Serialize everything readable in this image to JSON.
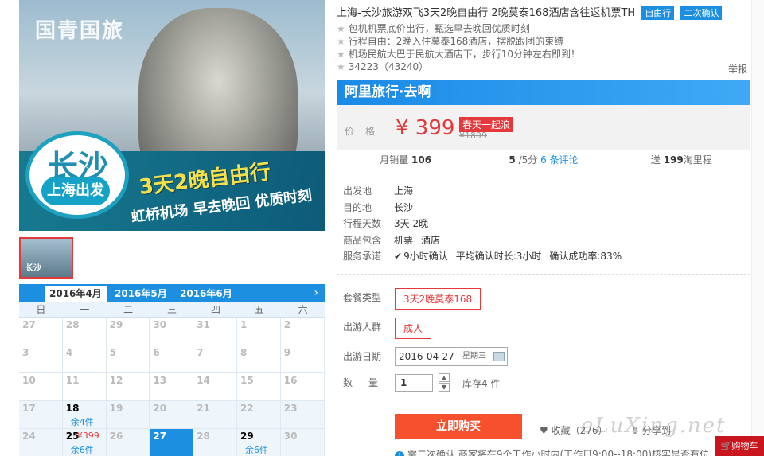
{
  "hero": {
    "brand": "国青国旅",
    "city": "长沙",
    "from": "上海出发",
    "slogan": "3天2晚自由行",
    "tags": "虹桥机场 早去晚回 优质时刻"
  },
  "thumb": {
    "label": "长沙"
  },
  "calendar": {
    "months": [
      "2016年4月",
      "2016年5月",
      "2016年6月"
    ],
    "weekdays": [
      "日",
      "一",
      "二",
      "三",
      "四",
      "五",
      "六"
    ],
    "cells": [
      {
        "d": "27"
      },
      {
        "d": "28"
      },
      {
        "d": "29"
      },
      {
        "d": "30"
      },
      {
        "d": "31"
      },
      {
        "d": "1"
      },
      {
        "d": "2"
      },
      {
        "d": "3"
      },
      {
        "d": "4"
      },
      {
        "d": "5"
      },
      {
        "d": "6"
      },
      {
        "d": "7"
      },
      {
        "d": "8"
      },
      {
        "d": "9"
      },
      {
        "d": "10"
      },
      {
        "d": "11"
      },
      {
        "d": "12"
      },
      {
        "d": "13"
      },
      {
        "d": "14"
      },
      {
        "d": "15"
      },
      {
        "d": "16"
      },
      {
        "d": "17"
      },
      {
        "d": "18",
        "s": "余4件",
        "avail": true
      },
      {
        "d": "19"
      },
      {
        "d": "20"
      },
      {
        "d": "21"
      },
      {
        "d": "22"
      },
      {
        "d": "23"
      },
      {
        "d": "24"
      },
      {
        "d": "25",
        "p": "¥399",
        "s": "余6件",
        "avail": true
      },
      {
        "d": "26"
      },
      {
        "d": "27",
        "s": "余4件",
        "sel": true
      },
      {
        "d": "28"
      },
      {
        "d": "29",
        "s": "余6件",
        "avail": true
      },
      {
        "d": "30"
      }
    ]
  },
  "product": {
    "title": "上海-长沙旅游双飞3天2晚自由行 2晚莫泰168酒店含往返机票TH",
    "badges": [
      "自由行",
      "二次确认"
    ],
    "features": [
      "包机机票底价出行，甄选早去晚回优质时刻",
      "行程自由：2晚入住莫泰168酒店，摆脱跟团的束缚",
      "机场民航大巴于民航大酒店下，步行10分钟左右即到！",
      "34223（43240）"
    ],
    "report": "举报"
  },
  "alitrip": {
    "label": "阿里旅行·去啊"
  },
  "price": {
    "label": "价格",
    "value": "¥ 399",
    "promo": "春天一起浪",
    "original": "¥1899"
  },
  "stats": {
    "sales_label": "月销量",
    "sales": "106",
    "score": "5",
    "score_suffix": "/5分",
    "reviews": "6 条评论",
    "points_prefix": "送",
    "points": "199",
    "points_suffix": "淘里程"
  },
  "info": [
    {
      "k": "出发地",
      "v": [
        "上海"
      ]
    },
    {
      "k": "目的地",
      "v": [
        "长沙"
      ]
    },
    {
      "k": "行程天数",
      "v": [
        "3天 2晚"
      ]
    },
    {
      "k": "商品包含",
      "v": [
        "机票",
        "酒店"
      ]
    },
    {
      "k": "服务承诺",
      "v": [
        "9小时确认",
        "平均确认时长:3小时",
        "确认成功率:83%"
      ]
    }
  ],
  "options": {
    "package_label": "套餐类型",
    "package_value": "3天2晚莫泰168",
    "people_label": "出游人群",
    "people_value": "成人",
    "date_label": "出游日期",
    "date_value": "2016-04-27",
    "weekday": "星期三",
    "qty_label": "数量",
    "qty_value": "1",
    "stock": "库存4 件"
  },
  "actions": {
    "buy": "立即购买",
    "fav": "收藏（276）",
    "share": "分享到",
    "note": "需二次确认 商家将在9个工作小时内(工作日9:00--18:00)核实是否有位",
    "cart": "购物车"
  },
  "watermark": "eLuXing.net"
}
